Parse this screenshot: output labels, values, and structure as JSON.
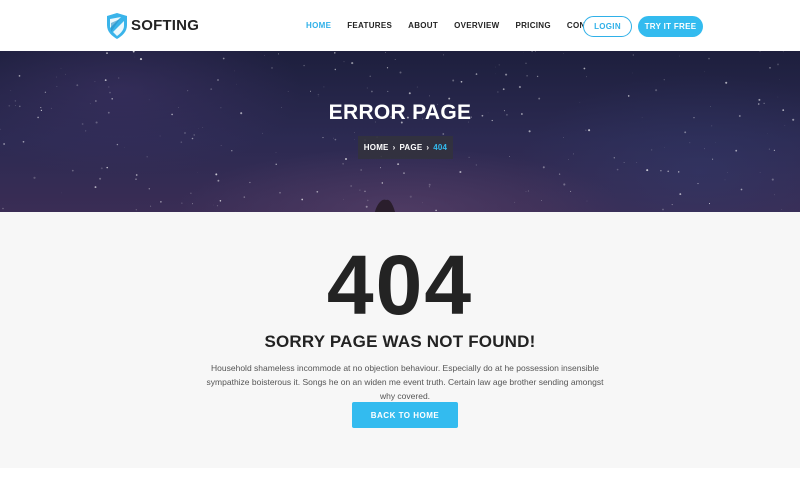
{
  "header": {
    "logo_text": "SOFTING",
    "nav": [
      {
        "label": "HOME",
        "active": true
      },
      {
        "label": "FEATURES",
        "active": false
      },
      {
        "label": "ABOUT",
        "active": false
      },
      {
        "label": "OVERVIEW",
        "active": false
      },
      {
        "label": "PRICING",
        "active": false
      },
      {
        "label": "CONTACT",
        "active": false
      }
    ],
    "login_label": "LOGIN",
    "try_label": "TRY IT FREE"
  },
  "hero": {
    "title": "ERROR PAGE",
    "breadcrumb": {
      "home": "HOME",
      "page": "PAGE",
      "current": "404"
    }
  },
  "main": {
    "code": "404",
    "headline": "SORRY PAGE WAS NOT FOUND!",
    "description": "Household shameless incommode at no objection behaviour. Especially do at he possession insensible sympathize boisterous it. Songs he on an widen me event truth. Certain law age brother sending amongst why covered.",
    "button_label": "BACK TO HOME"
  },
  "colors": {
    "accent": "#33bbef",
    "text": "#232323",
    "hero_dark": "#1d1f3d",
    "section_bg": "#f7f7f7"
  },
  "icons": {
    "logo": "shield-icon",
    "breadcrumb_separator": "chevron-right-icon"
  }
}
